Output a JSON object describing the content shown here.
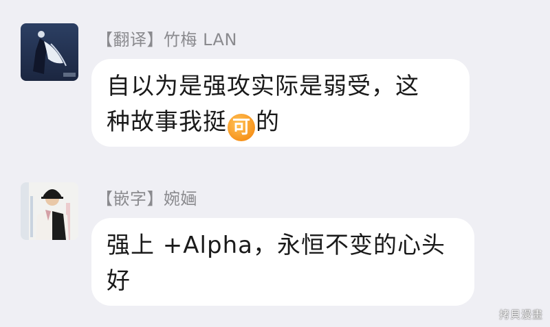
{
  "messages": [
    {
      "sender": "【翻译】竹梅 LAN",
      "text_line1": "自以为是强攻实际是弱受，这",
      "text_line2_before": "种故事我挺",
      "emoji_label": "可",
      "text_line2_after": "的"
    },
    {
      "sender": "【嵌字】婉婳",
      "text_line1": "强上 +Alpha，永恒不变的心头",
      "text_line2": "好"
    }
  ],
  "watermark": "拷貝漫畫"
}
